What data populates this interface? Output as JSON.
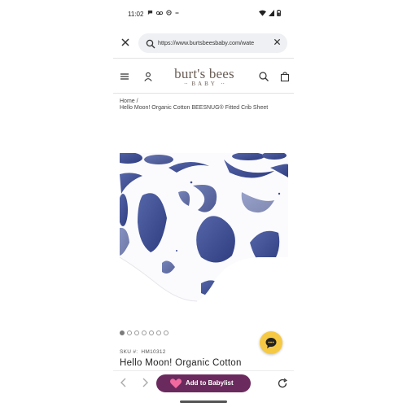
{
  "status_bar": {
    "time": "11:02",
    "icons_left": [
      "chat-icon",
      "voicemail-icon",
      "settings-icon",
      "dash-icon"
    ],
    "icons_right": [
      "wifi-icon",
      "signal-icon",
      "battery-icon"
    ]
  },
  "url_bar": {
    "url": "https://www.burtsbeesbaby.com/wate"
  },
  "site_header": {
    "logo_main": "burt's bees",
    "logo_sub": "BABY"
  },
  "breadcrumb": {
    "home": "Home",
    "separator": "/",
    "current": "Hello Moon! Organic Cotton BEESNUG® Fitted Crib Sheet"
  },
  "carousel": {
    "count": 7,
    "active_index": 0
  },
  "product": {
    "sku_label": "SKU #:",
    "sku_value": "HM10312",
    "title": "Hello Moon! Organic Cotton"
  },
  "bottom_bar": {
    "add_button_label": "Add to Babylist"
  },
  "colors": {
    "babylist": "#6b2a5d",
    "chat": "#f6c945",
    "moon": "#3f4f93"
  }
}
